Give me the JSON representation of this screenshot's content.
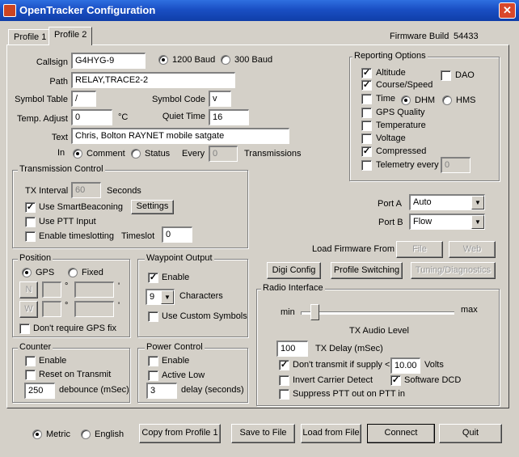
{
  "window": {
    "title": "OpenTracker Configuration",
    "close_glyph": "✕"
  },
  "tabs": [
    {
      "label": "Profile 1"
    },
    {
      "label": "Profile 2"
    }
  ],
  "firmware": {
    "label": "Firmware Build",
    "value": "54433"
  },
  "main": {
    "callsign_label": "Callsign",
    "callsign": "G4HYG-9",
    "baud_1200": "1200 Baud",
    "baud_300": "300 Baud",
    "path_label": "Path",
    "path": "RELAY,TRACE2-2",
    "symbol_table_label": "Symbol Table",
    "symbol_table": "/",
    "symbol_code_label": "Symbol Code",
    "symbol_code": "v",
    "temp_adjust_label": "Temp. Adjust",
    "temp_adjust": "0",
    "temp_unit": "°C",
    "quiet_time_label": "Quiet Time",
    "quiet_time": "16",
    "text_label": "Text",
    "text": "Chris, Bolton RAYNET mobile satgate",
    "in_label": "In",
    "comment": "Comment",
    "status": "Status",
    "every_label": "Every",
    "every_value": "0",
    "transmissions": "Transmissions"
  },
  "reporting": {
    "title": "Reporting Options",
    "altitude": "Altitude",
    "dao": "DAO",
    "course_speed": "Course/Speed",
    "time": "Time",
    "dhm": "DHM",
    "hms": "HMS",
    "gps_quality": "GPS Quality",
    "temperature": "Temperature",
    "voltage": "Voltage",
    "compressed": "Compressed",
    "telemetry_every": "Telemetry every",
    "telemetry_value": "0"
  },
  "transmission": {
    "title": "Transmission Control",
    "tx_interval_label": "TX Interval",
    "tx_interval": "60",
    "seconds": "Seconds",
    "smartbeaconing": "Use SmartBeaconing",
    "settings": "Settings",
    "ptt_input": "Use PTT Input",
    "timeslotting": "Enable timeslotting",
    "timeslot_label": "Timeslot",
    "timeslot": "0"
  },
  "ports": {
    "port_a_label": "Port A",
    "port_a": "Auto",
    "port_b_label": "Port B",
    "port_b": "Flow"
  },
  "firmware_load": {
    "label": "Load Firmware From",
    "file": "File",
    "web": "Web"
  },
  "buttons": {
    "digi_config": "Digi Config",
    "profile_switching": "Profile Switching",
    "tuning": "Tuning/Diagnostics"
  },
  "position": {
    "title": "Position",
    "gps": "GPS",
    "fixed": "Fixed",
    "n": "N",
    "w": "W",
    "deg": "°",
    "min": "'",
    "no_gps_fix": "Don't require GPS fix"
  },
  "waypoint": {
    "title": "Waypoint Output",
    "enable": "Enable",
    "characters_value": "9",
    "characters": "Characters",
    "custom_symbols": "Use Custom Symbols"
  },
  "radio": {
    "title": "Radio Interface",
    "min": "min",
    "max": "max",
    "audio_level": "TX Audio Level",
    "tx_delay": "100",
    "tx_delay_label": "TX Delay (mSec)",
    "supply_label": "Don't transmit if supply <",
    "supply": "10.00",
    "volts": "Volts",
    "invert_cd": "Invert Carrier Detect",
    "software_dcd": "Software DCD",
    "suppress_ptt": "Suppress PTT out on PTT in"
  },
  "counter": {
    "title": "Counter",
    "enable": "Enable",
    "reset": "Reset on Transmit",
    "debounce": "250",
    "debounce_label": "debounce (mSec)"
  },
  "power": {
    "title": "Power Control",
    "enable": "Enable",
    "active_low": "Active Low",
    "delay": "3",
    "delay_label": "delay (seconds)"
  },
  "footer": {
    "metric": "Metric",
    "english": "English",
    "copy": "Copy from Profile 1",
    "save": "Save to File",
    "load": "Load from File",
    "connect": "Connect",
    "quit": "Quit"
  },
  "check_glyph": "✓",
  "arrow_glyph": "▼"
}
